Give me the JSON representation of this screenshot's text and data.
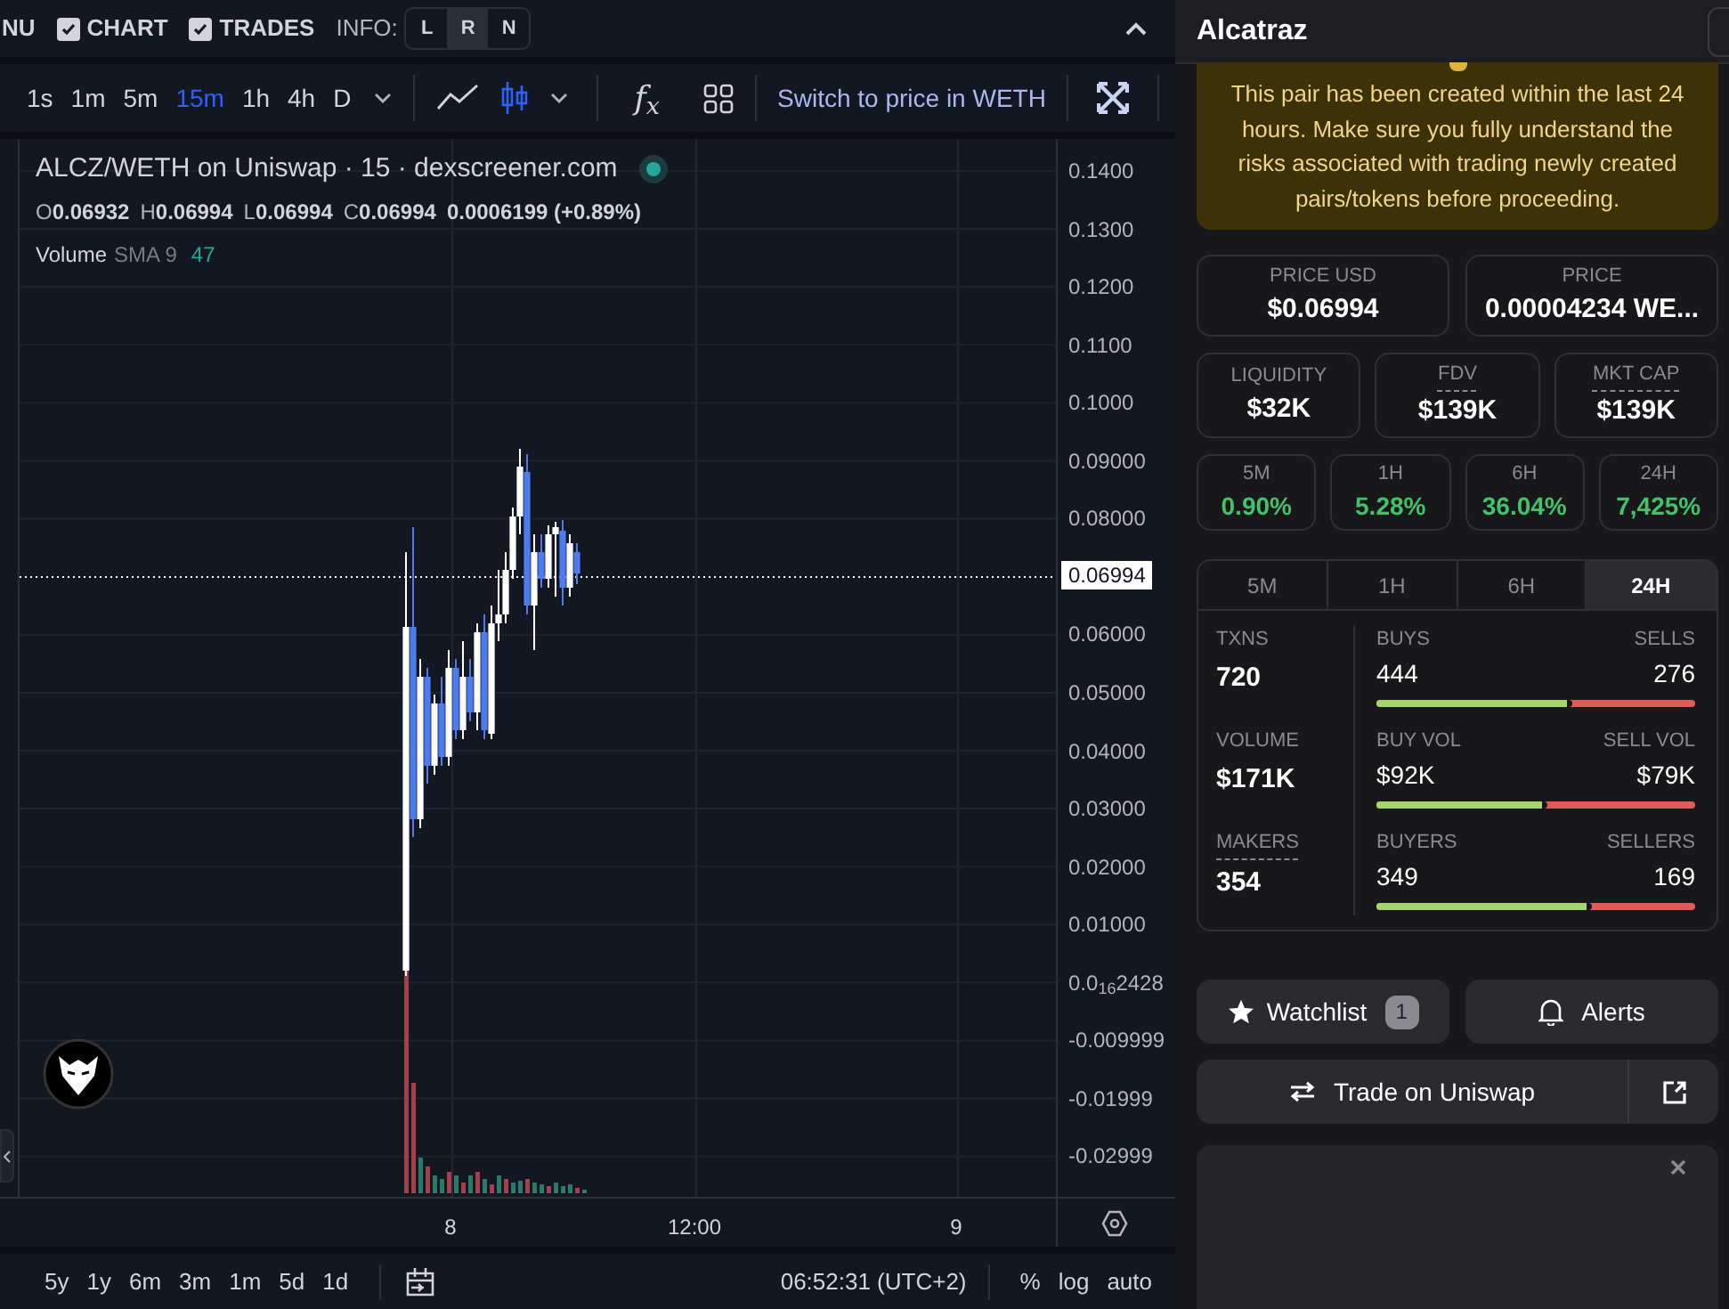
{
  "top_bar": {
    "menu_partial": "NU",
    "toggles": [
      {
        "label": "CHART",
        "checked": true
      },
      {
        "label": "TRADES",
        "checked": true
      }
    ],
    "info_label": "INFO:",
    "info_options": [
      {
        "label": "L",
        "selected": false
      },
      {
        "label": "R",
        "selected": true
      },
      {
        "label": "N",
        "selected": false
      }
    ]
  },
  "toolbar": {
    "intervals": [
      {
        "label": "1s",
        "selected": false
      },
      {
        "label": "1m",
        "selected": false
      },
      {
        "label": "5m",
        "selected": false
      },
      {
        "label": "15m",
        "selected": true
      },
      {
        "label": "1h",
        "selected": false
      },
      {
        "label": "4h",
        "selected": false
      },
      {
        "label": "D",
        "selected": false
      }
    ],
    "chart_types": [
      {
        "kind": "line",
        "selected": false
      },
      {
        "kind": "candles",
        "selected": true
      }
    ],
    "indicators_label": "f$_{x}$",
    "switch_label": "Switch to price in WETH"
  },
  "chart": {
    "legend_title": "ALCZ/WETH on Uniswap · 15 · dexscreener.com",
    "ohlc": [
      {
        "key": "O",
        "value": "0.06932"
      },
      {
        "key": "H",
        "value": "0.06994"
      },
      {
        "key": "L",
        "value": "0.06994"
      },
      {
        "key": "C",
        "value": "0.06994"
      }
    ],
    "change": "0.0006199 (+0.89%)",
    "volume_label": "Volume",
    "sma_label": "SMA 9",
    "sma_value": "47",
    "price_ticks": [
      "0.1400",
      "0.1300",
      "0.1200",
      "0.1100",
      "0.1000",
      "0.09000",
      "0.08000",
      "0.06000",
      "0.05000",
      "0.04000",
      "0.03000",
      "0.02000",
      "0.01000",
      "0.0$_{16}$2428",
      "-0.009999",
      "-0.01999",
      "-0.02999"
    ],
    "last_price": "0.06994",
    "time_ticks": [
      "8",
      "12:00",
      "9"
    ]
  },
  "bottom_bar": {
    "ranges": [
      "5y",
      "1y",
      "6m",
      "3m",
      "1m",
      "5d",
      "1d"
    ],
    "time": "06:52:31 (UTC+2)",
    "options": [
      "%",
      "log",
      "auto"
    ]
  },
  "sidebar": {
    "title": "Alcatraz",
    "warning": "This pair has been created within the last 24 hours. Make sure you fully understand the risks associated with trading newly created pairs/tokens before proceeding.",
    "price_cards": [
      {
        "label": "PRICE USD",
        "value": "$0.06994"
      },
      {
        "label": "PRICE",
        "value": "0.00004234 WE..."
      }
    ],
    "stats": [
      {
        "label": "LIQUIDITY",
        "value": "$32K",
        "dashed": false
      },
      {
        "label": "FDV",
        "value": "$139K",
        "dashed": true
      },
      {
        "label": "MKT CAP",
        "value": "$139K",
        "dashed": true
      }
    ],
    "changes": [
      {
        "label": "5M",
        "value": "0.90%"
      },
      {
        "label": "1H",
        "value": "5.28%"
      },
      {
        "label": "6H",
        "value": "36.04%"
      },
      {
        "label": "24H",
        "value": "7,425%"
      }
    ],
    "period_tabs": [
      {
        "label": "5M",
        "selected": false
      },
      {
        "label": "1H",
        "selected": false
      },
      {
        "label": "6H",
        "selected": false
      },
      {
        "label": "24H",
        "selected": true
      }
    ],
    "rows": [
      {
        "label": "TXNS",
        "value": "720",
        "dashed": false,
        "left_label": "BUYS",
        "left_value": "444",
        "right_label": "SELLS",
        "right_value": "276",
        "level": 0.617
      },
      {
        "label": "VOLUME",
        "value": "$171K",
        "dashed": false,
        "left_label": "BUY VOL",
        "left_value": "$92K",
        "right_label": "SELL VOL",
        "right_value": "$79K",
        "level": 0.538
      },
      {
        "label": "MAKERS",
        "value": "354",
        "dashed": true,
        "left_label": "BUYERS",
        "left_value": "349",
        "right_label": "SELLERS",
        "right_value": "169",
        "level": 0.674
      }
    ],
    "watchlist": {
      "label": "Watchlist",
      "count": "1"
    },
    "alerts_label": "Alerts",
    "trade_label": "Trade on Uniswap"
  }
}
